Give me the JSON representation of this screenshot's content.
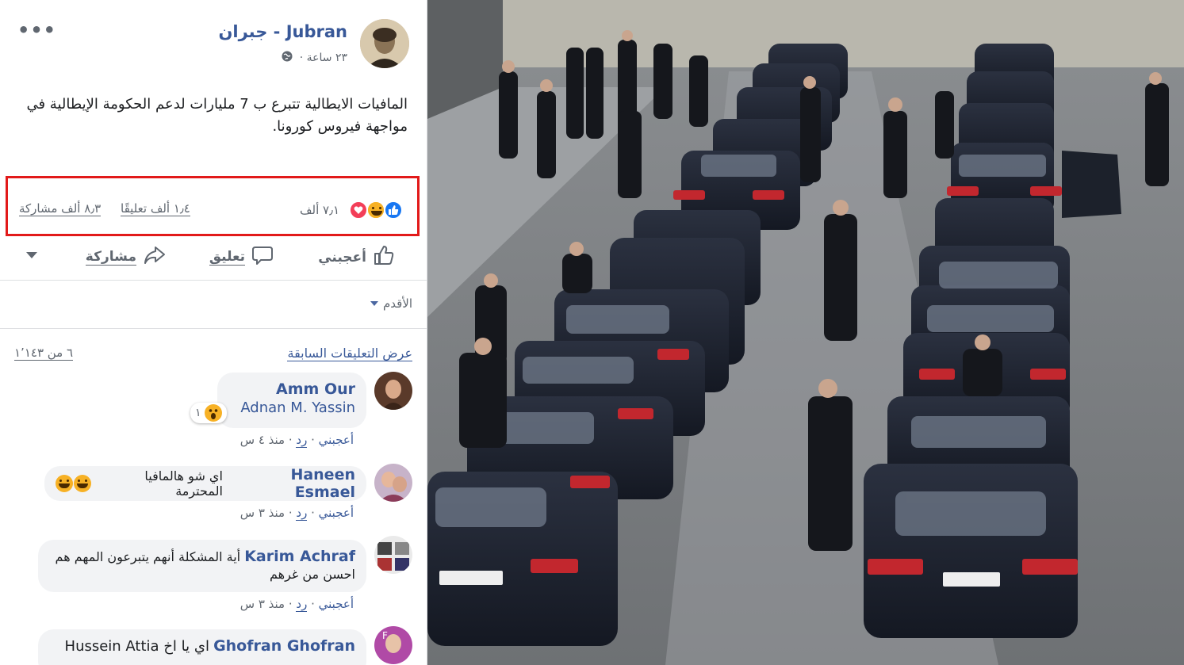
{
  "post": {
    "page_name": "جبران - Jubran",
    "time": "٢٣ ساعة ·",
    "privacy_icon": "globe-icon",
    "text": "المافيات الايطالية تتبرع ب 7 مليارات لدعم الحكومة الإيطالية في مواجهة فيروس كورونا.",
    "more_icon": "•••"
  },
  "stats": {
    "reactions_count": "٧٫١ ألف",
    "comments": "١٫٤ ألف تعليقًا",
    "shares": "٨٫٣ ألف مشاركة",
    "highlight_color": "#e21a1a"
  },
  "actions": {
    "like": "أعجبني",
    "comment": "تعليق",
    "share": "مشاركة"
  },
  "comments_section": {
    "sort_label": "الأقدم",
    "view_previous": "عرض التعليقات السابقة",
    "counter": "٦ من ١٬١٤٣",
    "items": [
      {
        "author": "Amm Our",
        "text": "Adnan M. Yassin",
        "reaction_count": "١",
        "like": "أعجبني",
        "reply": "رد",
        "time": "منذ ٤ س"
      },
      {
        "author": "Haneen Esmael",
        "text": "اي شو هالمافيا المحترمة",
        "like": "أعجبني",
        "reply": "رد",
        "time": "منذ ٣ س"
      },
      {
        "author": "Karim Achraf",
        "text_line1": "أية المشكلة أنهم يتبرعون المهم هم",
        "text_line2": "احسن من غرهم",
        "like": "أعجبني",
        "reply": "رد",
        "time": "منذ ٣ س"
      },
      {
        "author": "Ghofran Ghofran",
        "text": "اي يا اخ Hussein Attia"
      }
    ]
  },
  "brand_color": "#385898"
}
